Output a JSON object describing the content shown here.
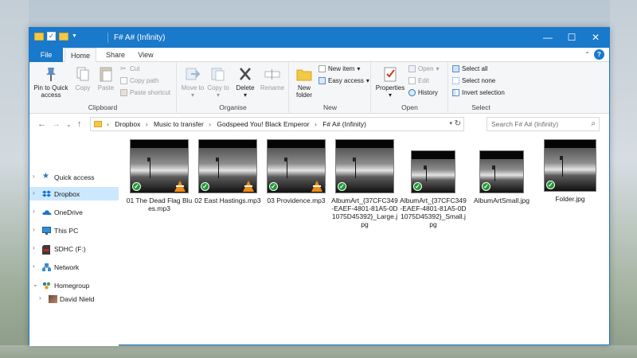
{
  "window": {
    "title": "F# A# (Infinity)",
    "accent": "#1979ca"
  },
  "tabs": {
    "file": "File",
    "home": "Home",
    "share": "Share",
    "view": "View"
  },
  "ribbon": {
    "clipboard": {
      "label": "Clipboard",
      "pin": "Pin to Quick access",
      "copy": "Copy",
      "paste": "Paste",
      "cut": "Cut",
      "copy_path": "Copy path",
      "paste_shortcut": "Paste shortcut"
    },
    "organise": {
      "label": "Organise",
      "move_to": "Move to",
      "copy_to": "Copy to",
      "delete": "Delete",
      "rename": "Rename"
    },
    "new": {
      "label": "New",
      "new_folder": "New folder",
      "new_item": "New item",
      "easy_access": "Easy access"
    },
    "open": {
      "label": "Open",
      "properties": "Properties",
      "open": "Open",
      "edit": "Edit",
      "history": "History"
    },
    "select": {
      "label": "Select",
      "select_all": "Select all",
      "select_none": "Select none",
      "invert": "Invert selection"
    }
  },
  "address": {
    "crumbs": [
      "Dropbox",
      "Music to transfer",
      "Godspeed You! Black Emperor",
      "F# A# (Infinity)"
    ],
    "search_placeholder": "Search F# A# (Infinity)"
  },
  "nav": {
    "items": [
      {
        "label": "Quick access",
        "icon": "star-icon"
      },
      {
        "label": "Dropbox",
        "icon": "dropbox-icon"
      },
      {
        "label": "OneDrive",
        "icon": "cloud-icon"
      },
      {
        "label": "This PC",
        "icon": "computer-icon"
      },
      {
        "label": "SDHC (F:)",
        "icon": "sd-card-icon"
      },
      {
        "label": "Network",
        "icon": "network-icon"
      },
      {
        "label": "Homegroup",
        "icon": "homegroup-icon"
      },
      {
        "label": "David Nield",
        "icon": "user-avatar-icon"
      }
    ]
  },
  "files": [
    {
      "name": "01 The Dead Flag Blues.mp3",
      "type": "mp3"
    },
    {
      "name": "02 East Hastings.mp3",
      "type": "mp3"
    },
    {
      "name": "03 Providence.mp3",
      "type": "mp3"
    },
    {
      "name": "AlbumArt_{37CFC349-EAEF-4801-81A5-0D1075D45392}_Large.jpg",
      "type": "jpg"
    },
    {
      "name": "AlbumArt_{37CFC349-EAEF-4801-81A5-0D1075D45392}_Small.jpg",
      "type": "jpg"
    },
    {
      "name": "AlbumArtSmall.jpg",
      "type": "jpg"
    },
    {
      "name": "Folder.jpg",
      "type": "jpg"
    }
  ]
}
